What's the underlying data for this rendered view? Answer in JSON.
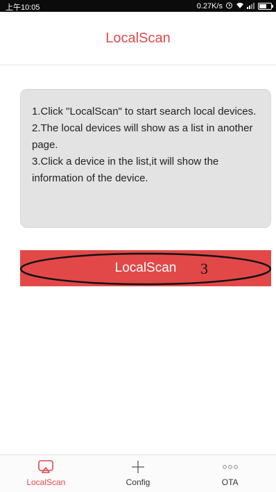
{
  "status_bar": {
    "time": "上午10:05",
    "network_speed": "0.27K/s",
    "alarm_icon": "alarm-clock-icon",
    "wifi_icon": "wifi-icon",
    "signal_icon": "signal-icon",
    "battery_icon": "battery-icon"
  },
  "header": {
    "title": "LocalScan"
  },
  "instructions": {
    "lines": [
      "1.Click \"LocalScan\" to start search local devices.",
      "2.The local devices will show as a list in another page.",
      "3.Click a device in the list,it will show the information of the device."
    ]
  },
  "scan_button": {
    "label": "LocalScan"
  },
  "annotation": {
    "number": "3"
  },
  "tabs": [
    {
      "label": "LocalScan",
      "icon": "cast-screen-icon",
      "active": true
    },
    {
      "label": "Config",
      "icon": "plus-icon",
      "active": false
    },
    {
      "label": "OTA",
      "icon": "more-dots-icon",
      "active": false
    }
  ],
  "colors": {
    "accent": "#e24848",
    "status_bar": "#0b0b0b",
    "card": "#e3e3e3"
  }
}
